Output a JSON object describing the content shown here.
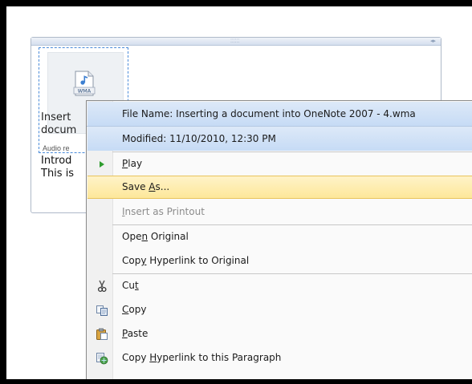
{
  "note": {
    "file_caption_line1": "Insert",
    "file_caption_line2": "docum",
    "audio_label": "Audio re",
    "text_line1": "Introd",
    "text_line2": "This is",
    "icon_label": "WMA"
  },
  "menu": {
    "file_name": "File Name: Inserting a document into OneNote 2007 - 4.wma",
    "modified": "Modified: 11/10/2010, 12:30 PM",
    "items": [
      {
        "pre": "",
        "key": "P",
        "post": "lay"
      },
      {
        "pre": "Save ",
        "key": "A",
        "post": "s..."
      },
      {
        "pre": "",
        "key": "I",
        "post": "nsert as Printout"
      },
      {
        "pre": "Ope",
        "key": "n",
        "post": " Original"
      },
      {
        "pre": "Cop",
        "key": "y",
        "post": " Hyperlink to Original"
      },
      {
        "pre": "Cu",
        "key": "t",
        "post": ""
      },
      {
        "pre": "",
        "key": "C",
        "post": "opy"
      },
      {
        "pre": "",
        "key": "P",
        "post": "aste"
      },
      {
        "pre": "Copy ",
        "key": "H",
        "post": "yperlink to this Paragraph"
      }
    ]
  },
  "colors": {
    "hover_bg": "#fde79a",
    "info_bg": "#c6dbf5",
    "play_arrow": "#2e9c2e"
  },
  "icons": [
    "wma-file-icon",
    "play-icon",
    "scissors-icon",
    "copy-icon",
    "paste-icon",
    "hyperlink-paragraph-icon"
  ]
}
